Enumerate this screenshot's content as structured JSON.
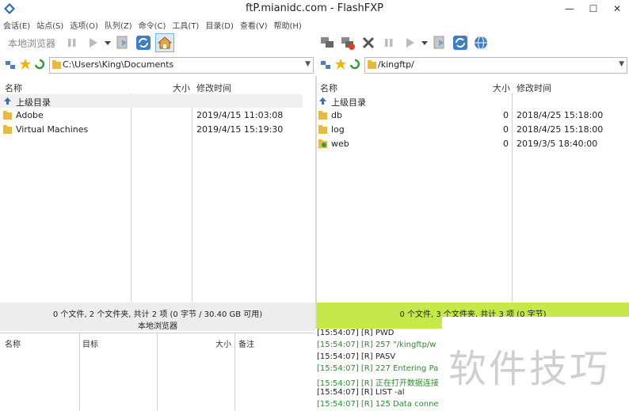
{
  "window": {
    "title": "ftP.mianidc.com - FlashFXP",
    "minimize": "—",
    "maximize": "☐",
    "close": "✕"
  },
  "menu": [
    "会话(E)",
    "站点(S)",
    "选项(O)",
    "队列(Z)",
    "命令(C)",
    "工具(T)",
    "目录(D)",
    "查看(V)",
    "帮助(H)"
  ],
  "left_toolbar": {
    "label": "本地浏览器"
  },
  "left_path": {
    "value": "C:\\Users\\King\\Documents"
  },
  "right_path": {
    "value": "/kingftp/"
  },
  "columns": {
    "name": "名称",
    "size": "大小",
    "modified": "修改时间"
  },
  "left_files": [
    {
      "name": "上级目录",
      "size": "",
      "modified": ""
    },
    {
      "name": "Adobe",
      "size": "",
      "modified": "2019/4/15 11:03:08"
    },
    {
      "name": "Virtual Machines",
      "size": "",
      "modified": "2019/4/15 15:19:30"
    }
  ],
  "right_files": [
    {
      "name": "上级目录",
      "size": "",
      "modified": ""
    },
    {
      "name": "db",
      "size": "0",
      "modified": "2018/4/25 15:18:00"
    },
    {
      "name": "log",
      "size": "0",
      "modified": "2018/4/25 15:18:00"
    },
    {
      "name": "web",
      "size": "0",
      "modified": "2019/3/5 18:40:00"
    }
  ],
  "left_status": {
    "line1": "0 个文件, 2 个文件夹, 共计 2 项 (0 字节 / 30.40 GB 可用)",
    "line2": "本地浏览器"
  },
  "right_status": {
    "line1": "0 个文件, 3 个文件夹, 共计 3 项 (0 字节)"
  },
  "queue_columns": {
    "name": "名称",
    "target": "目标",
    "size": "大小",
    "note": "备注"
  },
  "log_lines": [
    "[15:54:07] [R] PWD",
    "[15:54:07] [R] 257 \"/kingftp/w",
    "[15:54:07] [R] PASV",
    "[15:54:07] [R] 227 Entering Pa",
    "[15:54:07] [R] 正在打开数据连接",
    "[15:54:07] [R] LIST -al",
    "[15:54:07] [R] 125 Data conne"
  ],
  "watermark": "软件技巧",
  "colors": {
    "status_green": "#c6e84a",
    "log_green": "#2e8b2e",
    "log_dark": "#222222"
  }
}
